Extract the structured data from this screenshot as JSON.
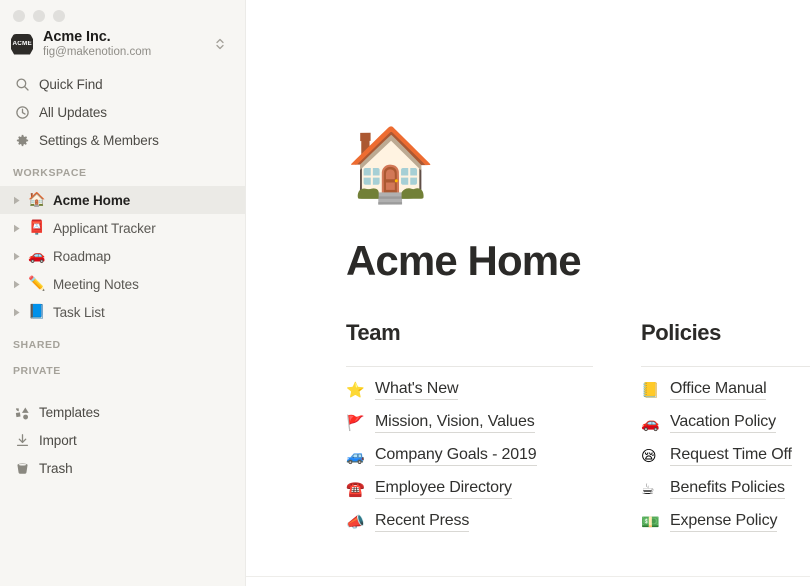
{
  "window": {
    "traffic_lights": [
      "close",
      "minimize",
      "zoom"
    ]
  },
  "sidebar": {
    "workspace": {
      "logo_text": "ACME",
      "name": "Acme Inc.",
      "email": "fig@makenotion.com",
      "switcher_icon": "chevron-up-down-icon"
    },
    "nav": [
      {
        "icon": "search-icon",
        "label": "Quick Find"
      },
      {
        "icon": "clock-icon",
        "label": "All Updates"
      },
      {
        "icon": "gear-icon",
        "label": "Settings & Members"
      }
    ],
    "sections": [
      {
        "label": "WORKSPACE"
      },
      {
        "label": "SHARED"
      },
      {
        "label": "PRIVATE"
      }
    ],
    "workspace_pages": [
      {
        "emoji": "🏠",
        "emoji_name": "house-emoji",
        "label": "Acme Home",
        "selected": true
      },
      {
        "emoji": "📮",
        "emoji_name": "postbox-emoji",
        "label": "Applicant Tracker",
        "selected": false
      },
      {
        "emoji": "🚗",
        "emoji_name": "car-emoji",
        "label": "Roadmap",
        "selected": false
      },
      {
        "emoji": "✏️",
        "emoji_name": "pencil-emoji",
        "label": "Meeting Notes",
        "selected": false
      },
      {
        "emoji": "📘",
        "emoji_name": "blue-book-emoji",
        "label": "Task List",
        "selected": false
      }
    ],
    "utilities": [
      {
        "icon": "templates-icon",
        "label": "Templates"
      },
      {
        "icon": "import-icon",
        "label": "Import"
      },
      {
        "icon": "trash-icon",
        "label": "Trash"
      }
    ]
  },
  "main": {
    "page_icon": "🏠",
    "page_icon_name": "house-emoji",
    "title": "Acme Home",
    "columns": [
      {
        "heading": "Team",
        "links": [
          {
            "emoji": "⭐",
            "emoji_name": "star-emoji",
            "label": "What's New"
          },
          {
            "emoji": "🚩",
            "emoji_name": "triangular-flag-emoji",
            "label": "Mission, Vision, Values"
          },
          {
            "emoji": "🚙",
            "emoji_name": "blue-car-emoji",
            "label": "Company Goals - 2019"
          },
          {
            "emoji": "☎️",
            "emoji_name": "telephone-emoji",
            "label": "Employee Directory"
          },
          {
            "emoji": "📣",
            "emoji_name": "megaphone-emoji",
            "label": "Recent Press"
          }
        ]
      },
      {
        "heading": "Policies",
        "links": [
          {
            "emoji": "📒",
            "emoji_name": "ledger-emoji",
            "label": "Office Manual"
          },
          {
            "emoji": "🚗",
            "emoji_name": "red-car-emoji",
            "label": "Vacation Policy"
          },
          {
            "emoji": "😪",
            "emoji_name": "sleepy-face-emoji",
            "label": "Request Time Off"
          },
          {
            "emoji": "☕",
            "emoji_name": "coffee-emoji",
            "label": "Benefits Policies"
          },
          {
            "emoji": "💵",
            "emoji_name": "dollar-banknote-emoji",
            "label": "Expense Policy"
          }
        ]
      }
    ]
  },
  "colors": {
    "sidebar_bg": "#f7f6f3",
    "content_bg": "#ffffff",
    "selected_row": "#ebeae6",
    "text_primary": "#2b2a28",
    "text_muted": "#8f8d87"
  }
}
